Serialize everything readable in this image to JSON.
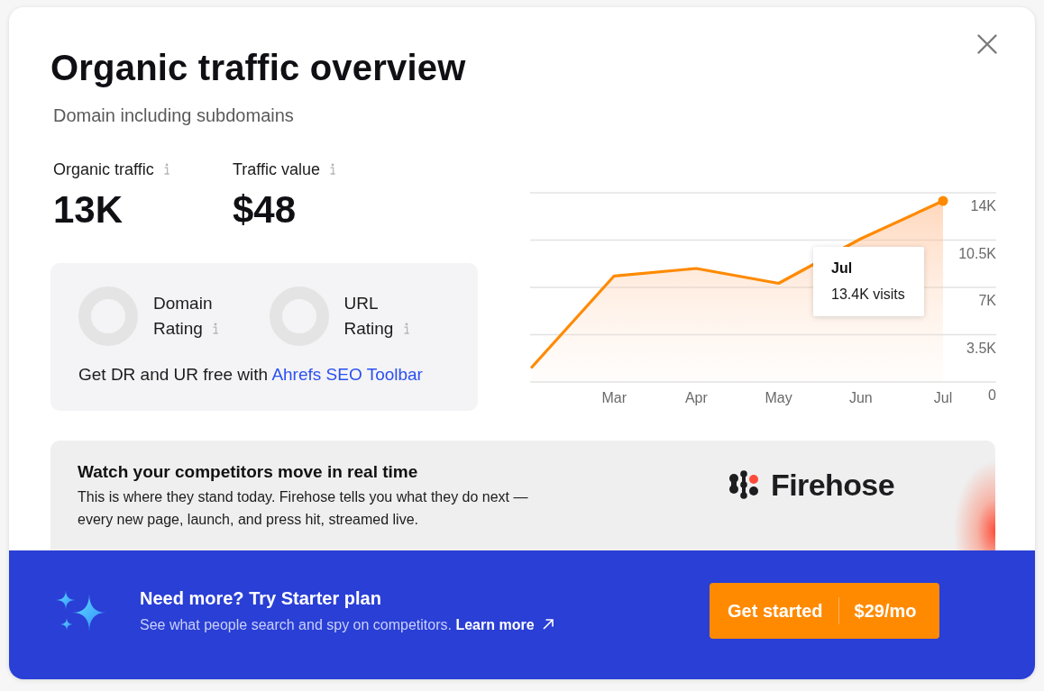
{
  "dialog": {
    "title": "Organic traffic overview",
    "subtitle": "Domain including subdomains"
  },
  "metrics": [
    {
      "label": "Organic traffic",
      "value": "13K"
    },
    {
      "label": "Traffic value",
      "value": "$48"
    }
  ],
  "ratings": {
    "items": [
      {
        "label": "Domain Rating"
      },
      {
        "label": "URL Rating"
      }
    ],
    "note": "Get DR and UR free with",
    "link": "Ahrefs SEO Toolbar"
  },
  "chart": {
    "chart_data": {
      "type": "area",
      "categories": [
        null,
        "Mar",
        "Apr",
        "May",
        "Jun",
        "Jul"
      ],
      "ylim": [
        0,
        14000
      ],
      "yticks": [
        {
          "value": 0,
          "label": "0"
        },
        {
          "value": 3500,
          "label": "3.5K"
        },
        {
          "value": 7000,
          "label": "7K"
        },
        {
          "value": 10500,
          "label": "10.5K"
        },
        {
          "value": 14000,
          "label": "14K"
        }
      ],
      "grid": true,
      "series": [
        {
          "color": "#ff8a00",
          "values": [
            1100,
            7850,
            8400,
            7300,
            10600,
            13400
          ]
        }
      ]
    },
    "tooltip": {
      "title": "Jul",
      "text": "13.4K visits"
    }
  },
  "promo": {
    "title": "Watch your competitors move in real time",
    "body": "This is where they stand today. Firehose tells you what they do next — every new page, launch, and press hit, streamed live.",
    "brand": "Firehose"
  },
  "upsell": {
    "title": "Need more? Try Starter plan",
    "text": "See what people search and spy on competitors.",
    "link": "Learn more",
    "button": {
      "label": "Get started",
      "price": "$29/mo"
    }
  }
}
